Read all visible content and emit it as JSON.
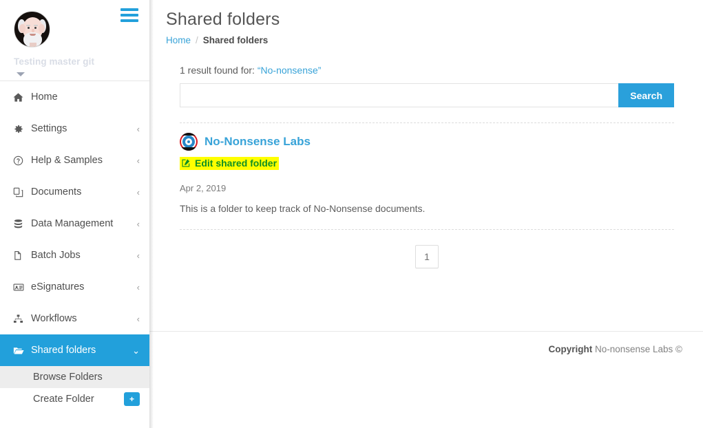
{
  "sidebar": {
    "profile": {
      "name": "Testing master git",
      "avatar_icon": "user-avatar",
      "caret_icon": "caret-down-icon"
    },
    "menu_toggle_icon": "hamburger-menu-icon",
    "items": [
      {
        "label": "Home",
        "icon": "home-icon",
        "chevron": "",
        "active": false
      },
      {
        "label": "Settings",
        "icon": "gear-icon",
        "chevron": "‹",
        "active": false
      },
      {
        "label": "Help & Samples",
        "icon": "question-circle-icon",
        "chevron": "‹",
        "active": false
      },
      {
        "label": "Documents",
        "icon": "documents-icon",
        "chevron": "‹",
        "active": false
      },
      {
        "label": "Data Management",
        "icon": "database-icon",
        "chevron": "‹",
        "active": false
      },
      {
        "label": "Batch Jobs",
        "icon": "file-copy-icon",
        "chevron": "‹",
        "active": false
      },
      {
        "label": "eSignatures",
        "icon": "id-card-icon",
        "chevron": "‹",
        "active": false
      },
      {
        "label": "Workflows",
        "icon": "sitemap-icon",
        "chevron": "‹",
        "active": false
      },
      {
        "label": "Shared folders",
        "icon": "open-folder-icon",
        "chevron": "⌄",
        "active": true
      }
    ],
    "sub_items": [
      {
        "label": "Browse Folders",
        "highlighted": true,
        "badge": ""
      },
      {
        "label": "Create Folder",
        "highlighted": false,
        "badge": "+"
      }
    ]
  },
  "header": {
    "title": "Shared folders",
    "breadcrumb": {
      "home": "Home",
      "separator": "/",
      "current": "Shared folders"
    }
  },
  "search": {
    "result_count_prefix": "1 result found for:",
    "result_term": "“No-nonsense”",
    "input_value": "",
    "input_placeholder": "",
    "button_label": "Search"
  },
  "result": {
    "logo_icon": "no-nonsense-labs-logo",
    "title": "No-Nonsense Labs",
    "edit_link_label": "Edit shared folder",
    "edit_icon": "pencil-square-icon",
    "date": "Apr 2, 2019",
    "description": "This is a folder to keep track of No-Nonsense documents."
  },
  "pagination": {
    "current_page": "1"
  },
  "footer": {
    "copyright_label": "Copyright",
    "copyright_text": "No-nonsense Labs ©"
  },
  "colors": {
    "accent": "#22a0db",
    "link": "#38a3d8",
    "highlight": "#ffff00",
    "highlight_text": "#0e8f24"
  }
}
